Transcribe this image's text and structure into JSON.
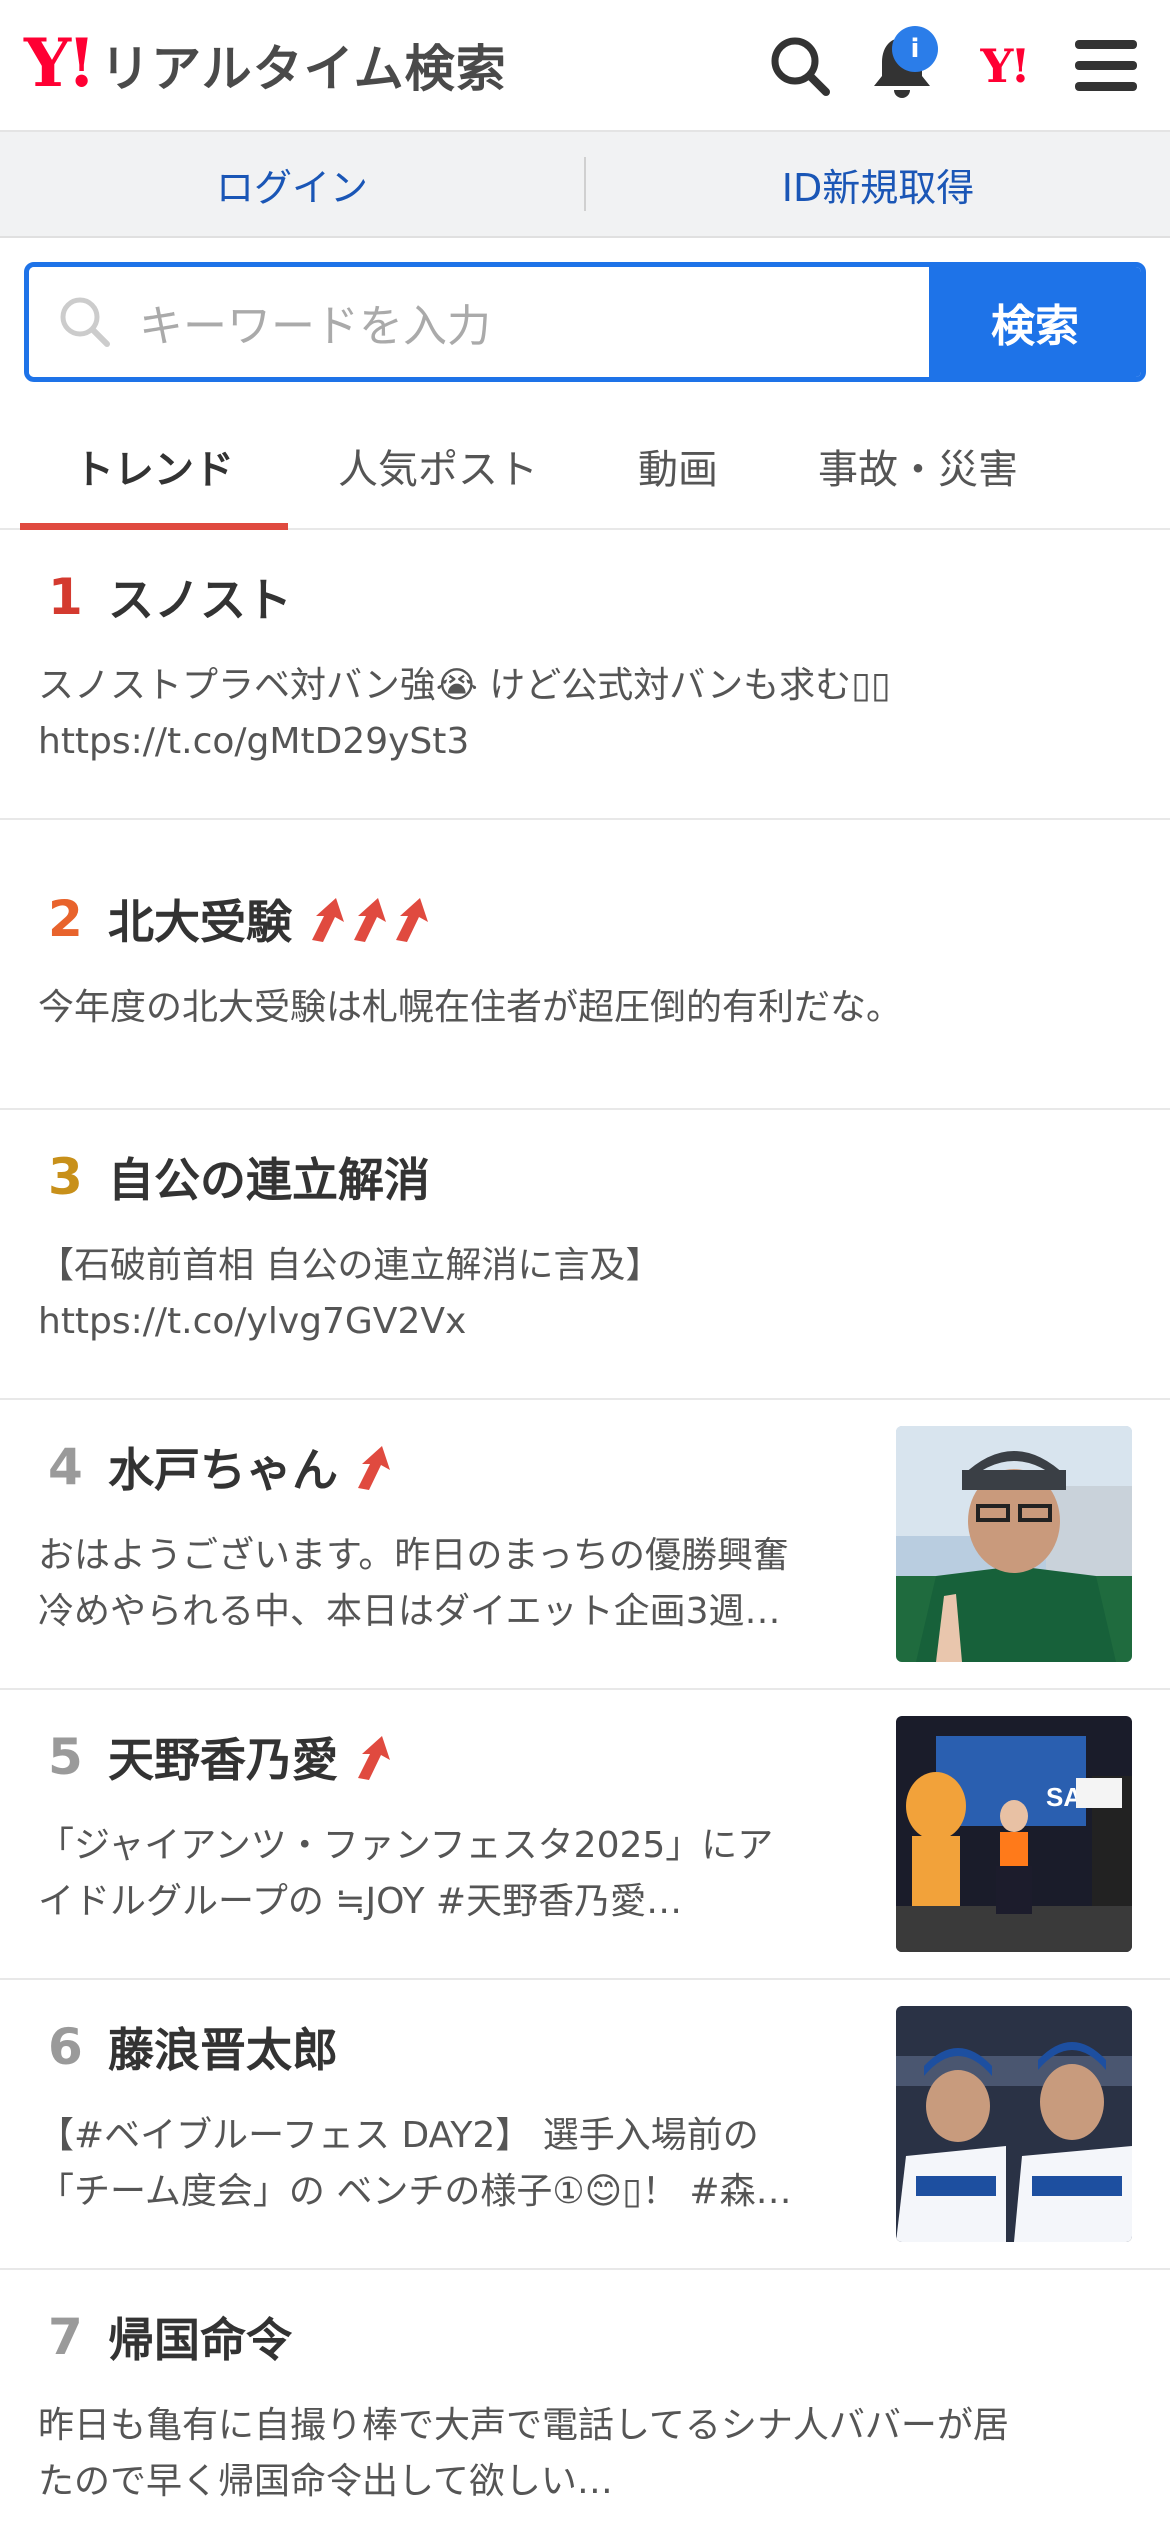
{
  "header": {
    "logo_y": "Y!",
    "logo_text": "リアルタイム検索",
    "notification_badge": "i",
    "ymark": "Y!"
  },
  "login_bar": {
    "login": "ログイン",
    "register": "ID新規取得"
  },
  "search": {
    "placeholder": "キーワードを入力",
    "button": "検索"
  },
  "tabs": [
    {
      "label": "トレンド",
      "active": true
    },
    {
      "label": "人気ポスト"
    },
    {
      "label": "動画"
    },
    {
      "label": "事故・災害"
    }
  ],
  "colors": {
    "rank1": "#d43a2f",
    "rank2": "#e8632c",
    "rank3": "#c8901a",
    "rank_other": "#9a9a9a",
    "arrow": "#e04a3f",
    "accent": "#1e73e8"
  },
  "trends": [
    {
      "rank": "1",
      "title": "スノスト",
      "arrows": 0,
      "line1": "スノストプラベ対バン強😭 けど公式対バンも求む▯▯",
      "line2": "https://t.co/gMtD29ySt3"
    },
    {
      "rank": "2",
      "title": "北大受験",
      "arrows": 3,
      "line1": "今年度の北大受験は札幌在住者が超圧倒的有利だな。",
      "line2": ""
    },
    {
      "rank": "3",
      "title": "自公の連立解消",
      "arrows": 0,
      "line1": "【石破前首相 自公の連立解消に言及】",
      "line2": "https://t.co/ylvg7GV2Vx"
    },
    {
      "rank": "4",
      "title": "水戸ちゃん",
      "arrows": 1,
      "line1": "おはようございます。昨日のまっちの優勝興奮",
      "line2": "冷めやられる中、本日はダイエット企画3週…"
    },
    {
      "rank": "5",
      "title": "天野香乃愛",
      "arrows": 1,
      "line1": "「ジャイアンツ・ファンフェスタ2025」にア",
      "line2": "イドルグループの ≒JOY #天野香乃愛…"
    },
    {
      "rank": "6",
      "title": "藤浪晋太郎",
      "arrows": 0,
      "line1": "【#ベイブルーフェス DAY2】 選手入場前の",
      "line2": "「チーム度会」の ベンチの様子①😊▯！ #森…"
    },
    {
      "rank": "7",
      "title": "帰国命令",
      "arrows": 0,
      "line1": "昨日も亀有に自撮り棒で大声で電話してるシナ人ババーが居",
      "line2": "たので早く帰国命令出して欲しい…"
    }
  ],
  "thumb_texts": {
    "mascot_letters": "SA"
  }
}
